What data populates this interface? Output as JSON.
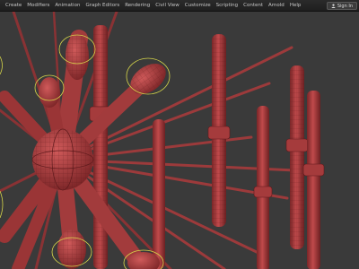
{
  "menubar": {
    "items": [
      "Create",
      "Modifiers",
      "Animation",
      "Graph Editors",
      "Rendering",
      "Civil View",
      "Customize",
      "Scripting",
      "Content",
      "Arnold",
      "Help"
    ]
  },
  "account": {
    "sign_in_label": "Sign In"
  },
  "colors": {
    "viewport_bg": "#3a3a3a",
    "mesh_fill": "#b03f40",
    "wire": "#5e1a1c",
    "selection_gizmo": "#d6d64a"
  },
  "icons": [
    "user-icon"
  ]
}
